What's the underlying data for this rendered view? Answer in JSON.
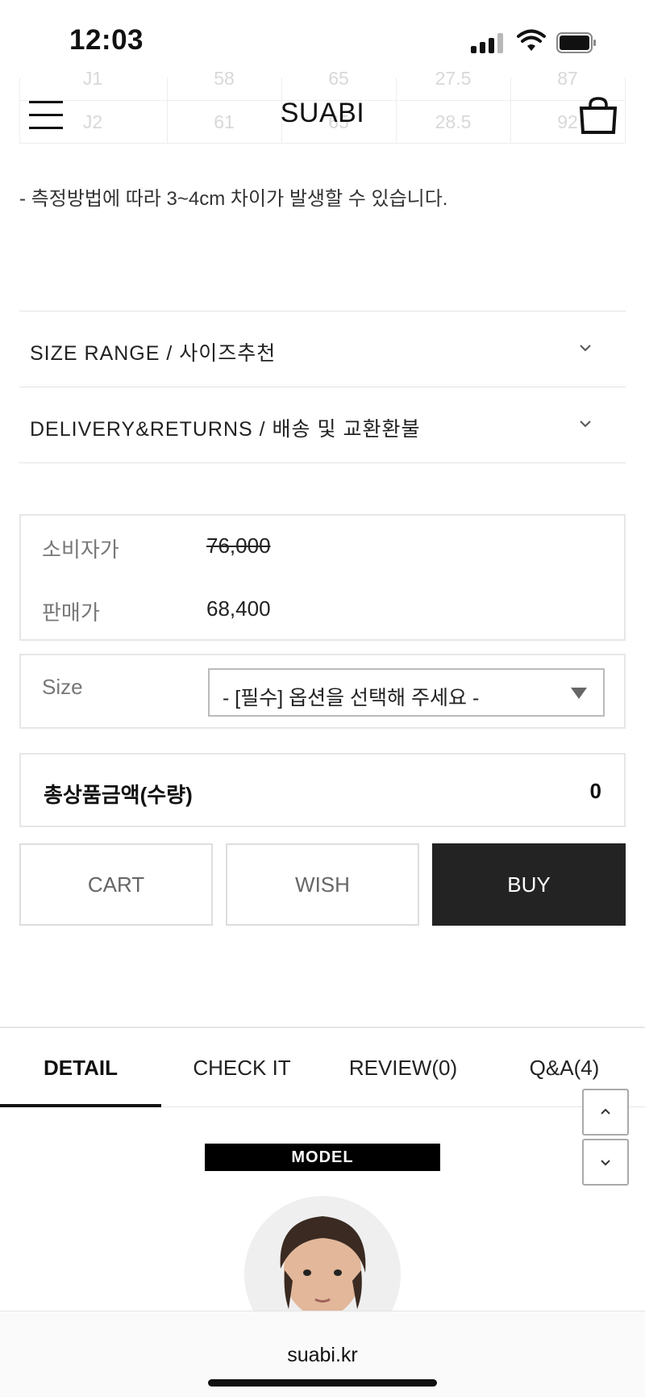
{
  "status_bar": {
    "time": "12:03"
  },
  "size_table_rows": [
    [
      "J1",
      "58",
      "65",
      "27.5",
      "87"
    ],
    [
      "J2",
      "61",
      "65",
      "28.5",
      "92"
    ]
  ],
  "header": {
    "brand": "SUABI",
    "menu_icon": "hamburger-menu-icon",
    "cart_icon": "shopping-bag-icon"
  },
  "note": "- 측정방법에 따라 3~4cm 차이가 발생할 수 있습니다.",
  "accordions": [
    {
      "label": "SIZE RANGE / 사이즈추천"
    },
    {
      "label": "DELIVERY&RETURNS / 배송 및 교환환불"
    }
  ],
  "price": {
    "consumer_label": "소비자가",
    "consumer_value": "76,000",
    "sale_label": "판매가",
    "sale_value": "68,400"
  },
  "option": {
    "label": "Size",
    "selected": "- [필수] 옵션을 선택해 주세요 -"
  },
  "total": {
    "label": "총상품금액(수량)",
    "value": "0"
  },
  "buttons": {
    "cart": "CART",
    "wish": "WISH",
    "buy": "BUY"
  },
  "tabs": [
    {
      "label": "DETAIL",
      "active": true
    },
    {
      "label": "CHECK IT",
      "active": false
    },
    {
      "label": "REVIEW(0)",
      "active": false
    },
    {
      "label": "Q&A(4)",
      "active": false
    }
  ],
  "detail": {
    "banner": "MODEL"
  },
  "browser": {
    "url": "suabi.kr"
  },
  "colors": {
    "buy_bg": "#232323",
    "border": "#e6e6e6",
    "text": "#222222"
  }
}
